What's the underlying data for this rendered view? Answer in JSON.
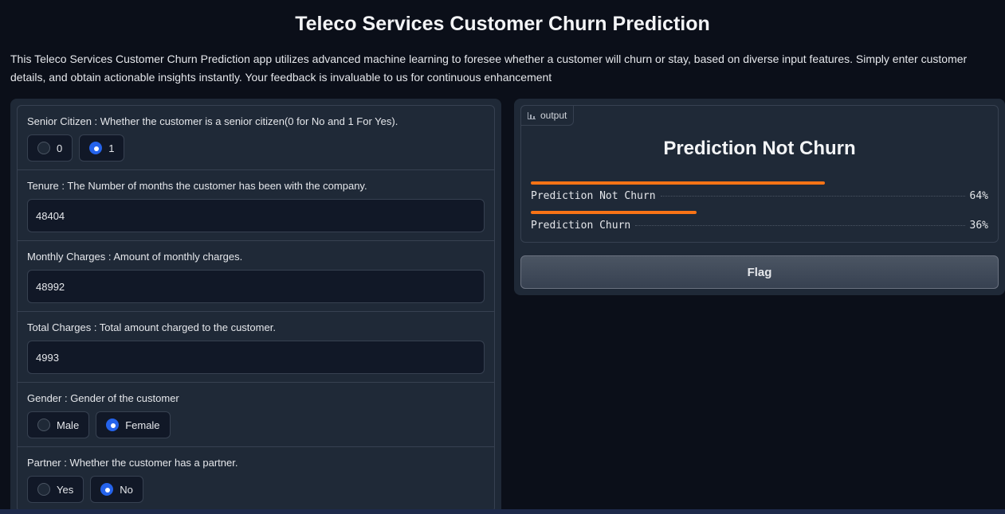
{
  "header": {
    "title": "Teleco Services Customer Churn Prediction",
    "description": "This Teleco Services Customer Churn Prediction app utilizes advanced machine learning to foresee whether a customer will churn or stay, based on diverse input features. Simply enter customer details, and obtain actionable insights instantly. Your feedback is invaluable to us for continuous enhancement"
  },
  "form": {
    "senior_citizen": {
      "label": "Senior Citizen : Whether the customer is a senior citizen(0 for No and 1 For Yes).",
      "options": [
        "0",
        "1"
      ],
      "selected": "1"
    },
    "tenure": {
      "label": "Tenure : The Number of months the customer has been with the company.",
      "value": "48404"
    },
    "monthly_charges": {
      "label": "Monthly Charges : Amount of monthly charges.",
      "value": "48992"
    },
    "total_charges": {
      "label": "Total Charges : Total amount charged to the customer.",
      "value": "4993"
    },
    "gender": {
      "label": "Gender : Gender of the customer",
      "options": [
        "Male",
        "Female"
      ],
      "selected": "Female"
    },
    "partner": {
      "label": "Partner : Whether the customer has a partner.",
      "options": [
        "Yes",
        "No"
      ],
      "selected": "No"
    }
  },
  "output": {
    "tag_label": "output",
    "tag_icon": "bar-chart-icon",
    "heading": "Prediction Not Churn",
    "confidences": [
      {
        "label": "Prediction Not Churn",
        "percent_text": "64%",
        "value": 0.64
      },
      {
        "label": "Prediction Churn",
        "percent_text": "36%",
        "value": 0.36
      }
    ],
    "bar_color": "#f97316"
  },
  "flag_button": {
    "label": "Flag"
  }
}
